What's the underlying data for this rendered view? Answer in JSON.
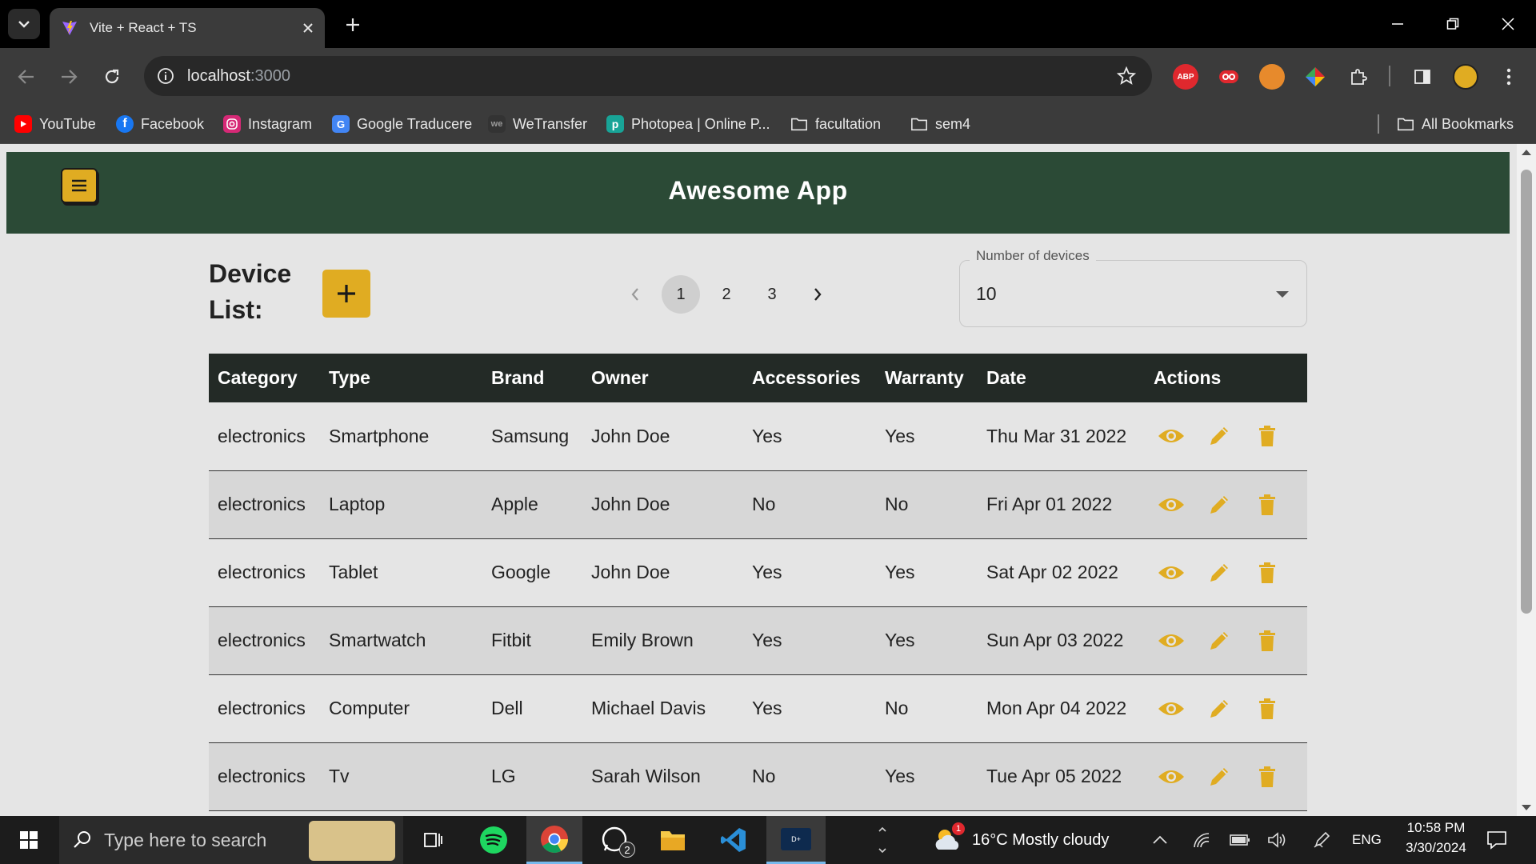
{
  "browser": {
    "tab_title": "Vite + React + TS",
    "url_host": "localhost",
    "url_port": ":3000",
    "bookmarks": [
      {
        "label": "YouTube",
        "icon": "youtube-icon",
        "color": "#ff0000"
      },
      {
        "label": "Facebook",
        "icon": "facebook-icon",
        "color": "#1877f2"
      },
      {
        "label": "Instagram",
        "icon": "instagram-icon",
        "color": "#d62976"
      },
      {
        "label": "Google Traducere",
        "icon": "google-translate-icon",
        "color": "#4285f4"
      },
      {
        "label": "WeTransfer",
        "icon": "wetransfer-icon",
        "color": "#333333"
      },
      {
        "label": "Photopea | Online P...",
        "icon": "photopea-icon",
        "color": "#18a497"
      },
      {
        "label": "facultation",
        "icon": "folder-icon",
        "color": ""
      },
      {
        "label": "sem4",
        "icon": "folder-icon",
        "color": ""
      }
    ],
    "all_bookmarks": "All Bookmarks",
    "extensions": [
      {
        "label": "ABP",
        "color": "#e0282e"
      },
      {
        "label": "oo",
        "color": "#e0282e"
      },
      {
        "label": "",
        "color": "#e78a2c"
      },
      {
        "label": "",
        "color": "#8e44ad"
      }
    ]
  },
  "app": {
    "title": "Awesome App",
    "list_title_line1": "Device",
    "list_title_line2": "List:",
    "add_label": "+",
    "pagination": {
      "pages": [
        "1",
        "2",
        "3"
      ],
      "current": "1"
    },
    "page_size": {
      "label": "Number of devices",
      "value": "10"
    },
    "accent_color": "#e0ac22",
    "header_color": "#2b4a36"
  },
  "table": {
    "columns": [
      "Category",
      "Type",
      "Brand",
      "Owner",
      "Accessories",
      "Warranty",
      "Date",
      "Actions"
    ],
    "rows": [
      [
        "electronics",
        "Smartphone",
        "Samsung",
        "John Doe",
        "Yes",
        "Yes",
        "Thu Mar 31 2022"
      ],
      [
        "electronics",
        "Laptop",
        "Apple",
        "John Doe",
        "No",
        "No",
        "Fri Apr 01 2022"
      ],
      [
        "electronics",
        "Tablet",
        "Google",
        "John Doe",
        "Yes",
        "Yes",
        "Sat Apr 02 2022"
      ],
      [
        "electronics",
        "Smartwatch",
        "Fitbit",
        "Emily Brown",
        "Yes",
        "Yes",
        "Sun Apr 03 2022"
      ],
      [
        "electronics",
        "Computer",
        "Dell",
        "Michael Davis",
        "Yes",
        "No",
        "Mon Apr 04 2022"
      ],
      [
        "electronics",
        "Tv",
        "LG",
        "Sarah Wilson",
        "No",
        "Yes",
        "Tue Apr 05 2022"
      ]
    ],
    "row_actions": [
      "view-icon",
      "edit-icon",
      "delete-icon"
    ]
  },
  "taskbar": {
    "search_placeholder": "Type here to search",
    "weather": "16°C  Mostly cloudy",
    "weather_badge": "1",
    "whatsapp_badge": "2",
    "language": "ENG",
    "time": "10:58 PM",
    "date": "3/30/2024"
  }
}
